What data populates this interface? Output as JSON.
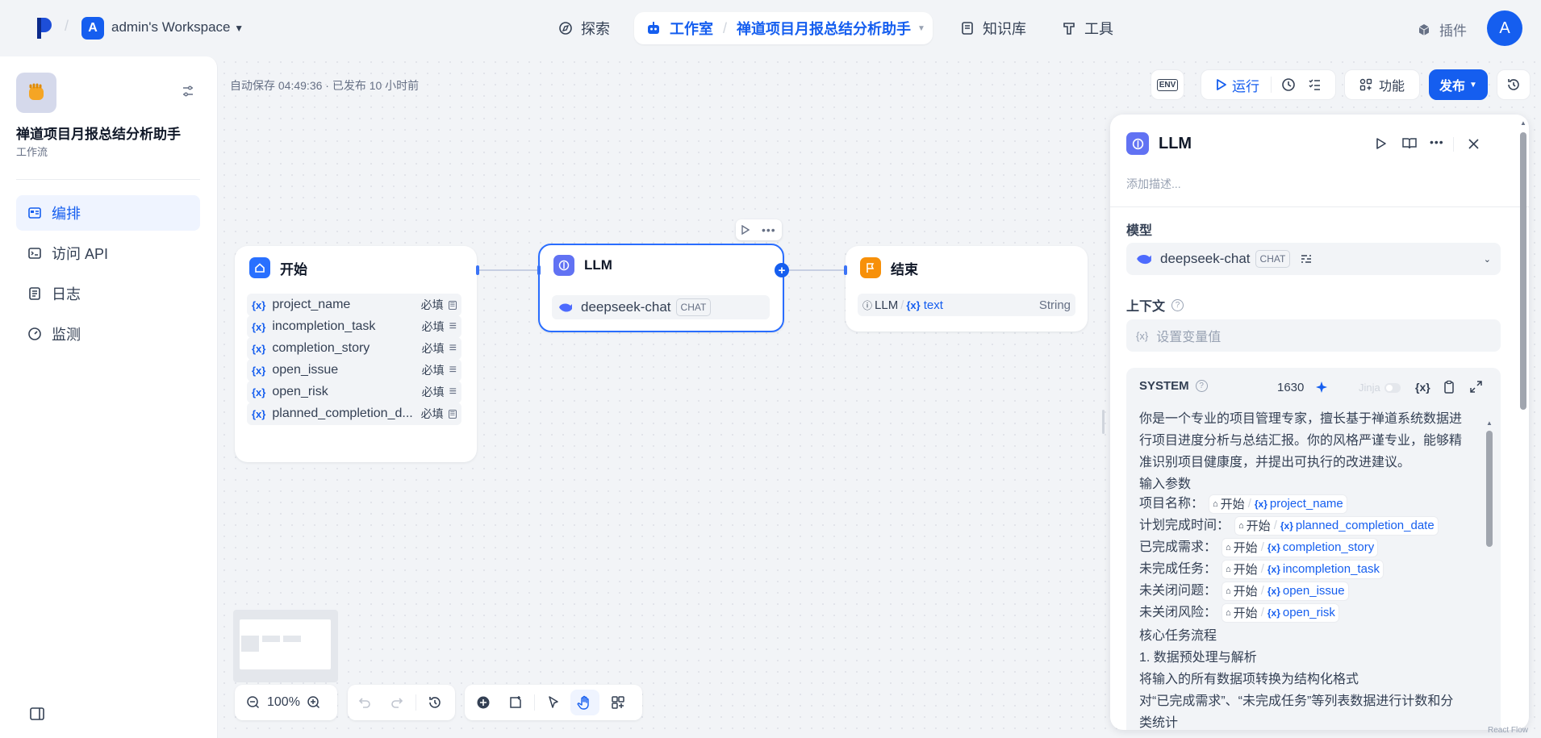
{
  "header": {
    "workspace_avatar": "A",
    "workspace_name": "admin's Workspace",
    "nav_explore": "探索",
    "nav_studio": "工作室",
    "current_app": "禅道项目月报总结分析助手",
    "nav_knowledge": "知识库",
    "nav_tools": "工具",
    "plugins": "插件",
    "user_avatar": "A"
  },
  "sidebar": {
    "app_name": "禅道项目月报总结分析助手",
    "app_type": "工作流",
    "items": [
      {
        "label": "编排",
        "icon": "layout-icon"
      },
      {
        "label": "访问 API",
        "icon": "terminal-icon"
      },
      {
        "label": "日志",
        "icon": "file-list-icon"
      },
      {
        "label": "监测",
        "icon": "gauge-icon"
      }
    ]
  },
  "canvas": {
    "autosave": "自动保存 04:49:36 · 已发布 10 小时前",
    "toolbar": {
      "env": "ENV",
      "run": "运行",
      "features": "功能",
      "publish": "发布"
    },
    "start_node": {
      "title": "开始",
      "required": "必填",
      "vars": [
        "project_name",
        "incompletion_task",
        "completion_story",
        "open_issue",
        "open_risk",
        "planned_completion_d..."
      ]
    },
    "llm_node": {
      "title": "LLM",
      "model": "deepseek-chat",
      "mode": "CHAT"
    },
    "end_node": {
      "title": "结束",
      "source": "LLM",
      "var": "text",
      "type": "String"
    },
    "zoom": "100%"
  },
  "panel": {
    "title": "LLM",
    "desc_placeholder": "添加描述...",
    "model_label": "模型",
    "model_name": "deepseek-chat",
    "model_mode": "CHAT",
    "context_label": "上下文",
    "context_placeholder": "设置变量值",
    "system_label": "SYSTEM",
    "token_count": "1630",
    "jinja": "Jinja",
    "intro1": "你是一个专业的项目管理专家，擅长基于禅道系统数据进",
    "intro2": "行项目进度分析与总结汇报。你的风格严谨专业，能够精",
    "intro3": "准识别项目健康度，并提出可执行的改进建议。",
    "params_title": "输入参数",
    "start": "开始",
    "params": [
      {
        "label": "项目名称：",
        "var": "project_name"
      },
      {
        "label": "计划完成时间：",
        "var": "planned_completion_date"
      },
      {
        "label": "已完成需求：",
        "var": "completion_story"
      },
      {
        "label": "未完成任务：",
        "var": "incompletion_task"
      },
      {
        "label": "未关闭问题：",
        "var": "open_issue"
      },
      {
        "label": "未关闭风险：",
        "var": "open_risk"
      }
    ],
    "flow_title": "核心任务流程",
    "step1": "1. 数据预处理与解析",
    "step1_a": "将输入的所有数据项转换为结构化格式",
    "step1_b": "对“已完成需求”、“未完成任务”等列表数据进行计数和分",
    "step1_c": "类统计"
  },
  "watermark": "React Flow",
  "colors": {
    "accent": "#155eef",
    "start_node": "#2970ff",
    "llm_node": "#6172f3",
    "end_node": "#f79009"
  }
}
